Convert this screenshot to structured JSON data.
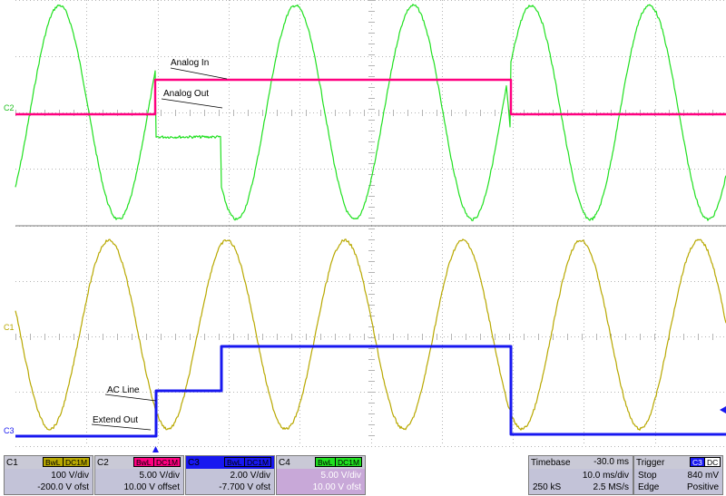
{
  "annotations": {
    "analog_in": "Analog In",
    "analog_out": "Analog Out",
    "ac_line": "AC Line",
    "extend_out": "Extend Out"
  },
  "channel_markers": {
    "c2_c4": "C2",
    "c1": "C1",
    "c3": "C3"
  },
  "colors": {
    "c1": "#b8a800",
    "c2": "#ff0080",
    "c3": "#1818f0",
    "c4": "#20e020",
    "grid": "#b4b4b4",
    "panel": "#c8c8d8"
  },
  "channels": [
    {
      "id": "C1",
      "bwl": "BwL",
      "coupling": "DC1M",
      "vdiv": "100 V/div",
      "offset": "-200.0 V ofst"
    },
    {
      "id": "C2",
      "bwl": "BwL",
      "coupling": "DC1M",
      "vdiv": "5.00 V/div",
      "offset": "10.00 V offset"
    },
    {
      "id": "C3",
      "bwl": "BwL",
      "coupling": "DC1M",
      "vdiv": "2.00 V/div",
      "offset": "-7.700 V ofst"
    },
    {
      "id": "C4",
      "bwl": "BwL",
      "coupling": "DC1M",
      "vdiv": "5.00 V/div",
      "offset": "10.00 V ofst"
    }
  ],
  "timebase": {
    "label": "Timebase",
    "delay": "-30.0 ms",
    "tdiv": "10.0 ms/div",
    "samples": "250 kS",
    "rate": "2.5 MS/s"
  },
  "trigger": {
    "label": "Trigger",
    "source": "C3",
    "coupling": "DC",
    "mode": "Stop",
    "level": "840 mV",
    "type": "Edge",
    "slope": "Positive"
  }
}
